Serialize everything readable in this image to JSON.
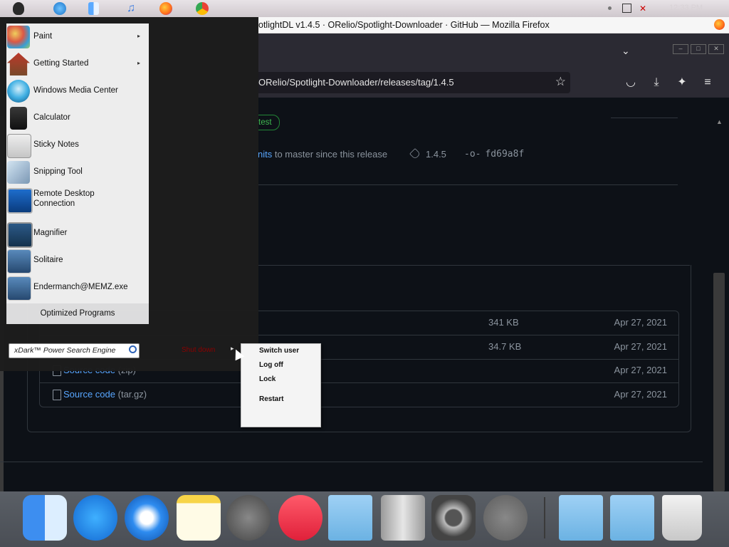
{
  "menubar": {
    "icons": [
      "apple-icon",
      "internet-explorer-icon",
      "finder-icon",
      "itunes-icon",
      "firefox-icon",
      "chrome-icon"
    ],
    "tray_icons": [
      "dot-icon",
      "battery-icon",
      "muted-speaker-icon"
    ],
    "clock": "12:33 PM"
  },
  "browser": {
    "window_title": "otlightDL v1.4.5 · ORelio/Spotlight-Downloader · GitHub — Mozilla Firefox",
    "url": "ORelio/Spotlight-Downloader/releases/tag/1.4.5",
    "controls": {
      "minimize": "–",
      "maximize": "□",
      "close": "✕"
    }
  },
  "page": {
    "badge": "test",
    "commits_link": "nits",
    "commits_text": " to master since this release",
    "tag": "1.4.5",
    "commit": "fd69a8f",
    "assets": [
      {
        "name": "",
        "sub": "",
        "size": "341 KB",
        "date": "Apr 27, 2021"
      },
      {
        "name": "",
        "sub": "",
        "size": "34.7 KB",
        "date": "Apr 27, 2021"
      },
      {
        "name": "Source code",
        "sub": "(zip)",
        "size": "",
        "date": "Apr 27, 2021"
      },
      {
        "name": "Source code",
        "sub": "(tar.gz)",
        "size": "",
        "date": "Apr 27, 2021"
      }
    ]
  },
  "start_menu": {
    "items": [
      {
        "label": "Paint",
        "has_arrow": true
      },
      {
        "label": "Getting Started",
        "has_arrow": true
      },
      {
        "label": "Windows Media Center",
        "has_arrow": false
      },
      {
        "label": "Calculator",
        "has_arrow": false
      },
      {
        "label": "Sticky Notes",
        "has_arrow": false
      },
      {
        "label": "Snipping Tool",
        "has_arrow": false
      },
      {
        "label": "Remote Desktop Connection",
        "has_arrow": false
      },
      {
        "label": "Magnifier",
        "has_arrow": false
      },
      {
        "label": "Solitaire",
        "has_arrow": false
      },
      {
        "label": "Endermanch@MEMZ.exe",
        "has_arrow": false
      }
    ],
    "optimized": "Optimized Programs",
    "search_placeholder": "xDark™ Power Search Engine",
    "shutdown": "Shut down",
    "arrow": "▸"
  },
  "context_menu": {
    "items": [
      "Switch user",
      "Log off",
      "Lock",
      "Restart"
    ]
  },
  "dock": {
    "icons": [
      "finder-icon",
      "app-store-icon",
      "safari-icon",
      "notes-icon",
      "launchpad-icon",
      "music-icon",
      "applications-folder-icon",
      "mac-pro-icon",
      "system-preferences-icon",
      "power-icon",
      "documents-folder-icon",
      "files-folder-icon",
      "trash-icon"
    ]
  },
  "colors": {
    "accent": "#58a6ff",
    "page_bg": "#0d1117",
    "border": "#30363d",
    "muted": "#8b949e",
    "badge": "#3fb950"
  }
}
